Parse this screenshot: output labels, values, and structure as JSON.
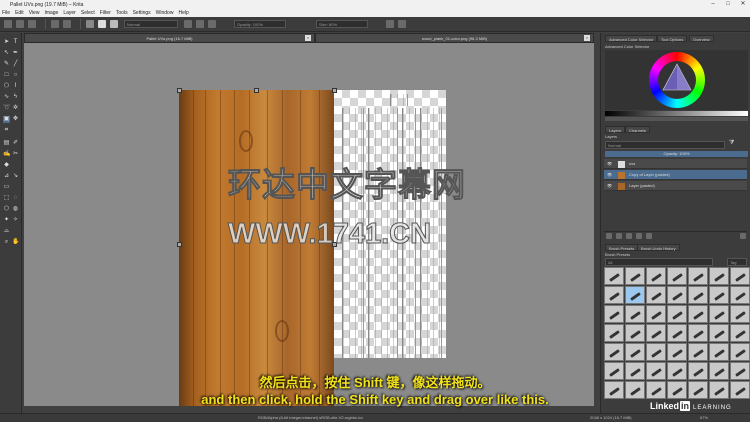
{
  "window": {
    "title": "Pallet UVs.png (19.7 MiB) – Krita"
  },
  "menu": [
    "File",
    "Edit",
    "View",
    "Image",
    "Layer",
    "Select",
    "Filter",
    "Tools",
    "Settings",
    "Window",
    "Help"
  ],
  "toolbar": {
    "blend_mode": "Normal",
    "opacity": "Opacity: 100%",
    "size": "Size: 60%"
  },
  "tabs": [
    {
      "label": "Pallet UVs.png (16.7 MiB)"
    },
    {
      "label": "wood_plank_01-color.png (96.3 MiB)"
    }
  ],
  "dock": {
    "top_tabs": [
      "Advanced Color Selector",
      "Tool Options",
      "Overview"
    ],
    "color_selector_title": "Advanced Color Selector",
    "layer_tabs": [
      "Layers",
      "Channels"
    ],
    "layers_title": "Layers",
    "blend_mode": "Normal",
    "opacity": "Opacity: 100%",
    "layers": [
      {
        "name": "uvs",
        "selected": false
      },
      {
        "name": "Copy of Layer (pasted)",
        "selected": true
      },
      {
        "name": "Layer (pasted)",
        "selected": false
      }
    ],
    "brush_tabs": [
      "Brush Presets",
      "Brush Undo History"
    ],
    "brush_presets_label": "Brush Presets",
    "brush_filter": "All",
    "brush_tag": "Tag"
  },
  "status": {
    "left": "RGB/Alpha (8-bit integer/channel)  sRGB-elle-V2-srgbtrc.icc",
    "right": "2048 x 1024 (16.7 MiB)",
    "zoom": "67%"
  },
  "watermark": {
    "line1": "环达中文字幕网",
    "line2": "WWW.1741.CN"
  },
  "subtitles": {
    "zh": "然后点击，按住 Shift 键，像这样拖动。",
    "en": "and then click, hold the Shift key and drag over like this."
  },
  "brand": {
    "name": "Linked",
    "in": "in",
    "tag": "LEARNING"
  },
  "colors": {
    "accent": "#4b6b8f",
    "subtitle": "#f2e21a",
    "canvas": "#8a8a8a"
  }
}
